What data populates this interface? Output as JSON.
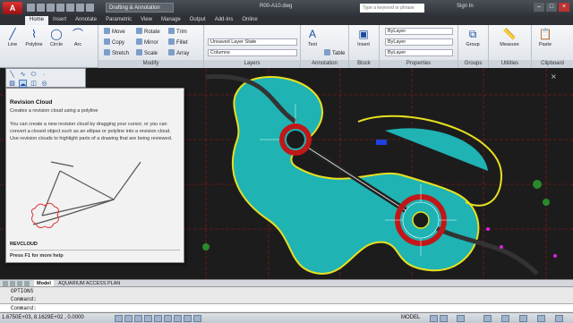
{
  "title_bar": {
    "app_letter": "A",
    "workspace": "Drafting & Annotation",
    "document": "R00-A10.dwg",
    "search_placeholder": "Type a keyword or phrase",
    "signin": "Sign In"
  },
  "tabs": [
    "Home",
    "Insert",
    "Annotate",
    "Parametric",
    "View",
    "Manage",
    "Output",
    "Add-Ins",
    "Online"
  ],
  "ribbon": {
    "draw": {
      "line": "Line",
      "polyline": "Polyline",
      "circle": "Circle",
      "arc": "Arc"
    },
    "modify": {
      "move": "Move",
      "rotate": "Rotate",
      "trim": "Trim",
      "copy": "Copy",
      "mirror": "Mirror",
      "fillet": "Fillet",
      "stretch": "Stretch",
      "scale": "Scale",
      "array": "Array",
      "label": "Modify"
    },
    "layers": {
      "state": "Unsaved Layer State",
      "current": "Columns",
      "label": "Layers"
    },
    "annotation": {
      "text": "Text",
      "table": "Table",
      "label": "Annotation"
    },
    "block": {
      "insert": "Insert",
      "label": "Block"
    },
    "properties": {
      "color": "ByLayer",
      "linetype": "ByLayer",
      "lineweight": "ByLayer",
      "label": "Properties"
    },
    "groups": {
      "group": "Group",
      "label": "Groups"
    },
    "utilities": {
      "measure": "Measure",
      "label": "Utilities"
    },
    "clipboard": {
      "paste": "Paste",
      "label": "Clipboard"
    }
  },
  "tooltip": {
    "title": "Revision Cloud",
    "subtitle": "Creates a revision cloud using a polyline",
    "body": "You can create a new revision cloud by dragging your cursor, or you can convert a closed object such as an ellipse or polyline into a revision cloud. Use revision clouds to highlight parts of a drawing that are being reviewed.",
    "command": "REVCLOUD",
    "help": "Press F1 for more help"
  },
  "layout_tabs": {
    "model": "Model",
    "layout": "AQUARIUM ACCESS PLAN"
  },
  "command_window": {
    "history": "OPTIONS",
    "line2": "Command:",
    "prompt": "Command:"
  },
  "status_bar": {
    "coordinates": "1.6750E+03, 8.1629E+02 , 0.0000",
    "model": "MODEL"
  },
  "colors": {
    "accent": "#2a5d9f",
    "canvas": "#1c1c1c",
    "cyan_fill": "#1fb3b3",
    "red_ring": "#c01818",
    "yellow_outline": "#e8e020"
  }
}
